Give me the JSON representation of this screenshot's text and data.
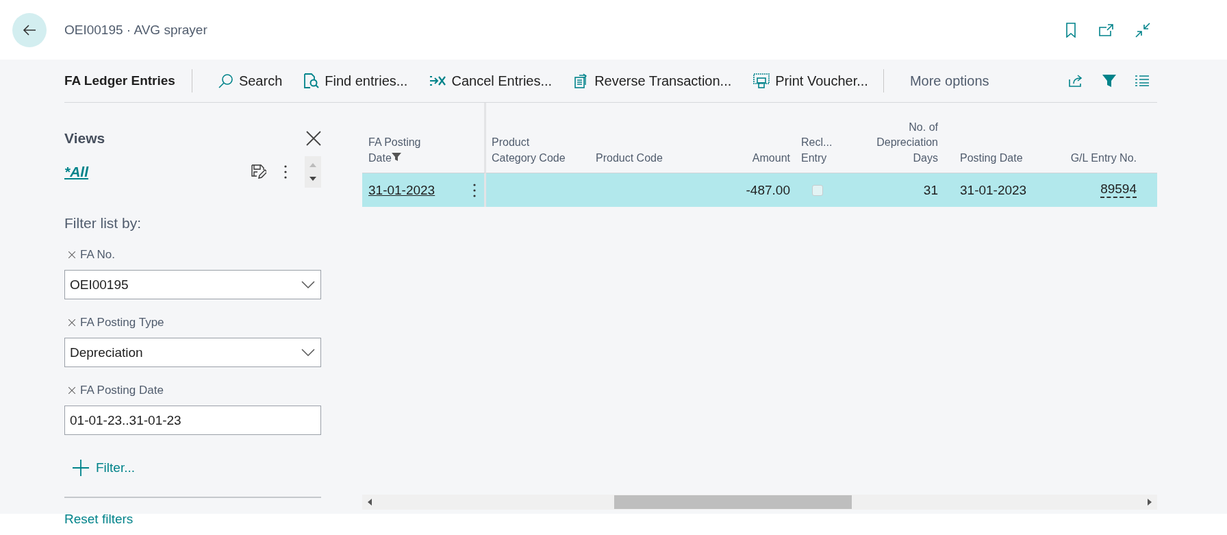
{
  "header": {
    "title": "OEI00195 · AVG sprayer"
  },
  "toolbar": {
    "title": "FA Ledger Entries",
    "actions": [
      {
        "label": "Search"
      },
      {
        "label": "Find entries..."
      },
      {
        "label": "Cancel Entries..."
      },
      {
        "label": "Reverse Transaction..."
      },
      {
        "label": "Print Voucher..."
      }
    ],
    "more": "More options"
  },
  "views": {
    "title": "Views",
    "current": "*All",
    "filter_heading": "Filter list by:",
    "filters": [
      {
        "label": "FA No.",
        "value": "OEI00195",
        "kind": "dropdown"
      },
      {
        "label": "FA Posting Type",
        "value": "Depreciation",
        "kind": "dropdown"
      },
      {
        "label": "FA Posting Date",
        "value": "01-01-23..31-01-23",
        "kind": "text"
      }
    ],
    "add_filter": "Filter...",
    "reset": "Reset filters"
  },
  "table": {
    "columns": [
      {
        "label": "FA Posting Date",
        "filtered": true
      },
      {
        "label": "Product Category Code",
        "filtered": false
      },
      {
        "label": "Product Code",
        "filtered": false
      },
      {
        "label": "Amount",
        "filtered": false
      },
      {
        "label": "Recl... Entry",
        "filtered": false
      },
      {
        "label": "No. of Depreciation Days",
        "filtered": false
      },
      {
        "label": "Posting Date",
        "filtered": false
      },
      {
        "label": "G/L Entry No.",
        "filtered": false
      }
    ],
    "rows": [
      {
        "selected": true,
        "cells": [
          {
            "kind": "link",
            "text": "31-01-2023"
          },
          {
            "kind": "empty"
          },
          {
            "kind": "empty"
          },
          {
            "kind": "text",
            "text": "-487.00"
          },
          {
            "kind": "checkbox",
            "checked": false
          },
          {
            "kind": "text",
            "text": "31"
          },
          {
            "kind": "text",
            "text": "31-01-2023"
          },
          {
            "kind": "drilldown",
            "text": "89594"
          }
        ]
      }
    ]
  }
}
